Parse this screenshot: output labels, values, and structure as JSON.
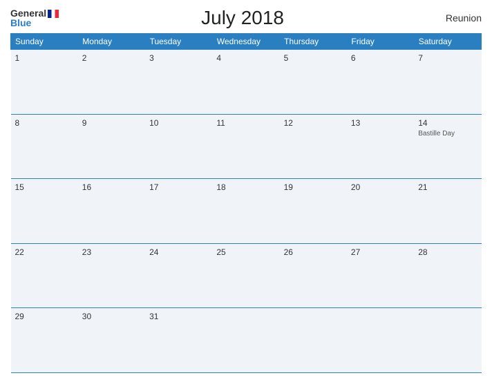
{
  "header": {
    "logo_general": "General",
    "logo_blue": "Blue",
    "title": "July 2018",
    "region": "Reunion"
  },
  "weekdays": [
    "Sunday",
    "Monday",
    "Tuesday",
    "Wednesday",
    "Thursday",
    "Friday",
    "Saturday"
  ],
  "weeks": [
    [
      {
        "day": "1",
        "event": ""
      },
      {
        "day": "2",
        "event": ""
      },
      {
        "day": "3",
        "event": ""
      },
      {
        "day": "4",
        "event": ""
      },
      {
        "day": "5",
        "event": ""
      },
      {
        "day": "6",
        "event": ""
      },
      {
        "day": "7",
        "event": ""
      }
    ],
    [
      {
        "day": "8",
        "event": ""
      },
      {
        "day": "9",
        "event": ""
      },
      {
        "day": "10",
        "event": ""
      },
      {
        "day": "11",
        "event": ""
      },
      {
        "day": "12",
        "event": ""
      },
      {
        "day": "13",
        "event": ""
      },
      {
        "day": "14",
        "event": "Bastille Day"
      }
    ],
    [
      {
        "day": "15",
        "event": ""
      },
      {
        "day": "16",
        "event": ""
      },
      {
        "day": "17",
        "event": ""
      },
      {
        "day": "18",
        "event": ""
      },
      {
        "day": "19",
        "event": ""
      },
      {
        "day": "20",
        "event": ""
      },
      {
        "day": "21",
        "event": ""
      }
    ],
    [
      {
        "day": "22",
        "event": ""
      },
      {
        "day": "23",
        "event": ""
      },
      {
        "day": "24",
        "event": ""
      },
      {
        "day": "25",
        "event": ""
      },
      {
        "day": "26",
        "event": ""
      },
      {
        "day": "27",
        "event": ""
      },
      {
        "day": "28",
        "event": ""
      }
    ],
    [
      {
        "day": "29",
        "event": ""
      },
      {
        "day": "30",
        "event": ""
      },
      {
        "day": "31",
        "event": ""
      },
      {
        "day": "",
        "event": ""
      },
      {
        "day": "",
        "event": ""
      },
      {
        "day": "",
        "event": ""
      },
      {
        "day": "",
        "event": ""
      }
    ]
  ]
}
